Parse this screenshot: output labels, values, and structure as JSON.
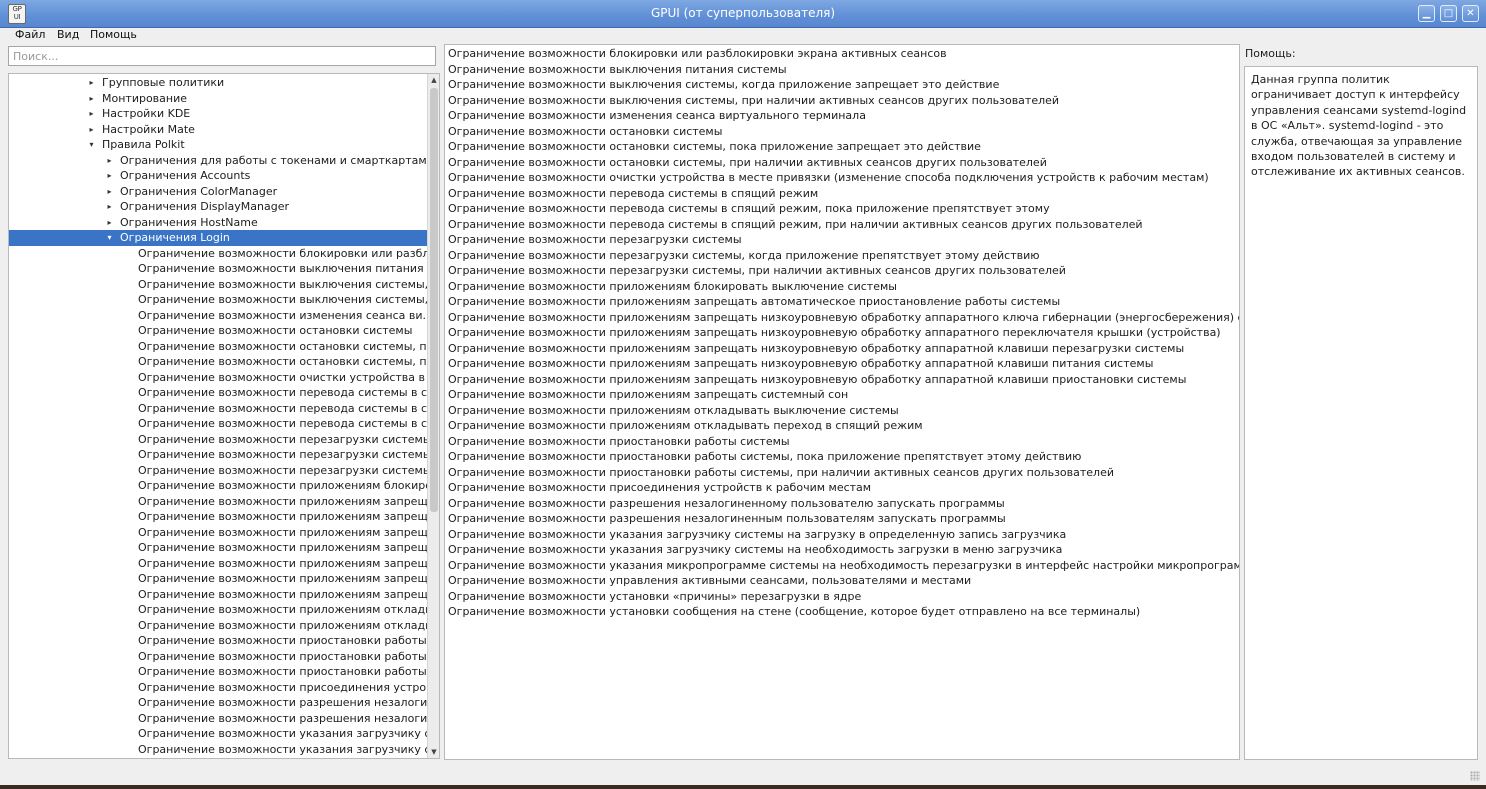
{
  "window": {
    "title": "GPUI (от суперпользователя)",
    "icon_text": "GP UI",
    "controls": [
      "minimize",
      "maximize",
      "close"
    ]
  },
  "menubar": {
    "items": [
      {
        "label": "Файл"
      },
      {
        "label": "Вид"
      },
      {
        "label": "Помощь"
      }
    ]
  },
  "search": {
    "placeholder": "Поиск...",
    "value": ""
  },
  "tree": {
    "rows": [
      {
        "label": "Групповые политики",
        "arrow": "▸",
        "depth": 0
      },
      {
        "label": "Монтирование",
        "arrow": "▸",
        "depth": 0
      },
      {
        "label": "Настройки KDE",
        "arrow": "▸",
        "depth": 0
      },
      {
        "label": "Настройки Mate",
        "arrow": "▸",
        "depth": 0
      },
      {
        "label": "Правила Polkit",
        "arrow": "▾",
        "depth": 0
      },
      {
        "label": "Ограничения для работы с токенами и смарткартами",
        "arrow": "▸",
        "depth": 1
      },
      {
        "label": "Ограничения Accounts",
        "arrow": "▸",
        "depth": 1
      },
      {
        "label": "Ограничения ColorManager",
        "arrow": "▸",
        "depth": 1
      },
      {
        "label": "Ограничения DisplayManager",
        "arrow": "▸",
        "depth": 1
      },
      {
        "label": "Ограничения HostName",
        "arrow": "▸",
        "depth": 1
      },
      {
        "label": "Ограничения Login",
        "arrow": "▾",
        "depth": 1,
        "selected": true
      },
      {
        "label": "Ограничение возможности блокировки или разбл...",
        "arrow": "",
        "depth": 2
      },
      {
        "label": "Ограничение возможности выключения питания ...",
        "arrow": "",
        "depth": 2
      },
      {
        "label": "Ограничение возможности выключения системы, ...",
        "arrow": "",
        "depth": 2
      },
      {
        "label": "Ограничение возможности выключения системы, ...",
        "arrow": "",
        "depth": 2
      },
      {
        "label": "Ограничение возможности изменения сеанса ви...",
        "arrow": "",
        "depth": 2
      },
      {
        "label": "Ограничение возможности остановки системы",
        "arrow": "",
        "depth": 2
      },
      {
        "label": "Ограничение возможности остановки системы, по...",
        "arrow": "",
        "depth": 2
      },
      {
        "label": "Ограничение возможности остановки системы, пр...",
        "arrow": "",
        "depth": 2
      },
      {
        "label": "Ограничение возможности очистки устройства в ...",
        "arrow": "",
        "depth": 2
      },
      {
        "label": "Ограничение возможности перевода системы в сп...",
        "arrow": "",
        "depth": 2
      },
      {
        "label": "Ограничение возможности перевода системы в сп...",
        "arrow": "",
        "depth": 2
      },
      {
        "label": "Ограничение возможности перевода системы в сп...",
        "arrow": "",
        "depth": 2
      },
      {
        "label": "Ограничение возможности перезагрузки системы",
        "arrow": "",
        "depth": 2
      },
      {
        "label": "Ограничение возможности перезагрузки системы,...",
        "arrow": "",
        "depth": 2
      },
      {
        "label": "Ограничение возможности перезагрузки системы,...",
        "arrow": "",
        "depth": 2
      },
      {
        "label": "Ограничение возможности приложениям блокиро...",
        "arrow": "",
        "depth": 2
      },
      {
        "label": "Ограничение возможности приложениям запрещ...",
        "arrow": "",
        "depth": 2
      },
      {
        "label": "Ограничение возможности приложениям запрещ...",
        "arrow": "",
        "depth": 2
      },
      {
        "label": "Ограничение возможности приложениям запрещ...",
        "arrow": "",
        "depth": 2
      },
      {
        "label": "Ограничение возможности приложениям запрещ...",
        "arrow": "",
        "depth": 2
      },
      {
        "label": "Ограничение возможности приложениям запрещ...",
        "arrow": "",
        "depth": 2
      },
      {
        "label": "Ограничение возможности приложениям запрещ...",
        "arrow": "",
        "depth": 2
      },
      {
        "label": "Ограничение возможности приложениям запрещ...",
        "arrow": "",
        "depth": 2
      },
      {
        "label": "Ограничение возможности приложениям отклады...",
        "arrow": "",
        "depth": 2
      },
      {
        "label": "Ограничение возможности приложениям отклады...",
        "arrow": "",
        "depth": 2
      },
      {
        "label": "Ограничение возможности приостановки работы ...",
        "arrow": "",
        "depth": 2
      },
      {
        "label": "Ограничение возможности приостановки работы ...",
        "arrow": "",
        "depth": 2
      },
      {
        "label": "Ограничение возможности приостановки работы ...",
        "arrow": "",
        "depth": 2
      },
      {
        "label": "Ограничение возможности присоединения устро...",
        "arrow": "",
        "depth": 2
      },
      {
        "label": "Ограничение возможности разрешения незалоги...",
        "arrow": "",
        "depth": 2
      },
      {
        "label": "Ограничение возможности разрешения незалоги...",
        "arrow": "",
        "depth": 2
      },
      {
        "label": "Ограничение возможности указания загрузчику с...",
        "arrow": "",
        "depth": 2
      },
      {
        "label": "Ограничение возможности указания загрузчику с...",
        "arrow": "",
        "depth": 2
      }
    ]
  },
  "policies": [
    "Ограничение возможности блокировки или разблокировки экрана активных сеансов",
    "Ограничение возможности выключения питания системы",
    "Ограничение возможности выключения системы, когда приложение запрещает это действие",
    "Ограничение возможности выключения системы, при наличии активных сеансов других пользователей",
    "Ограничение возможности изменения сеанса виртуального терминала",
    "Ограничение возможности остановки системы",
    "Ограничение возможности остановки системы, пока приложение запрещает это действие",
    "Ограничение возможности остановки системы, при наличии активных сеансов других пользователей",
    "Ограничение возможности очистки устройства в месте привязки (изменение способа подключения устройств к рабочим местам)",
    "Ограничение возможности перевода системы в спящий режим",
    "Ограничение возможности перевода системы в спящий режим, пока приложение препятствует этому",
    "Ограничение возможности перевода системы в спящий режим, при наличии активных сеансов других пользователей",
    "Ограничение возможности перезагрузки системы",
    "Ограничение возможности перезагрузки системы, когда приложение препятствует этому действию",
    "Ограничение возможности перезагрузки системы, при наличии активных сеансов других пользователей",
    "Ограничение возможности приложениям блокировать выключение системы",
    "Ограничение возможности приложениям запрещать автоматическое приостановление работы системы",
    "Ограничение возможности приложениям запрещать низкоуровневую обработку аппаратного ключа гибернации (энергосбережения) системы",
    "Ограничение возможности приложениям запрещать низкоуровневую обработку аппаратного переключателя крышки (устройства)",
    "Ограничение возможности приложениям запрещать низкоуровневую обработку аппаратной клавиши перезагрузки системы",
    "Ограничение возможности приложениям запрещать низкоуровневую обработку аппаратной клавиши питания системы",
    "Ограничение возможности приложениям запрещать низкоуровневую обработку аппаратной клавиши приостановки системы",
    "Ограничение возможности приложениям запрещать системный сон",
    "Ограничение возможности приложениям откладывать выключение системы",
    "Ограничение возможности приложениям откладывать переход в спящий режим",
    "Ограничение возможности приостановки работы системы",
    "Ограничение возможности приостановки работы системы, пока приложение препятствует этому действию",
    "Ограничение возможности приостановки работы системы, при наличии активных сеансов других пользователей",
    "Ограничение возможности присоединения устройств к рабочим местам",
    "Ограничение возможности разрешения незалогиненному пользователю запускать программы",
    "Ограничение возможности разрешения незалогиненным пользователям запускать программы",
    "Ограничение возможности указания загрузчику системы на загрузку в определенную запись загрузчика",
    "Ограничение возможности указания загрузчику системы на необходимость загрузки в меню загрузчика",
    "Ограничение возможности указания микропрограмме системы на необходимость перезагрузки в интерфейс настройки микропрограммы",
    "Ограничение возможности управления активными сеансами, пользователями и местами",
    "Ограничение возможности установки «причины» перезагрузки в ядре",
    "Ограничение возможности установки сообщения на стене (сообщение, которое будет отправлено на все терминалы)"
  ],
  "help": {
    "label": "Помощь:",
    "text": "Данная группа политик ограничивает доступ к интерфейсу управления сеансами systemd-logind в ОС «Альт». systemd-logind - это служба, отвечающая за управление входом пользователей в систему и отслеживание их активных сеансов."
  },
  "colors": {
    "titlebar": "#5f8fd6",
    "selection": "#3a74c6"
  }
}
